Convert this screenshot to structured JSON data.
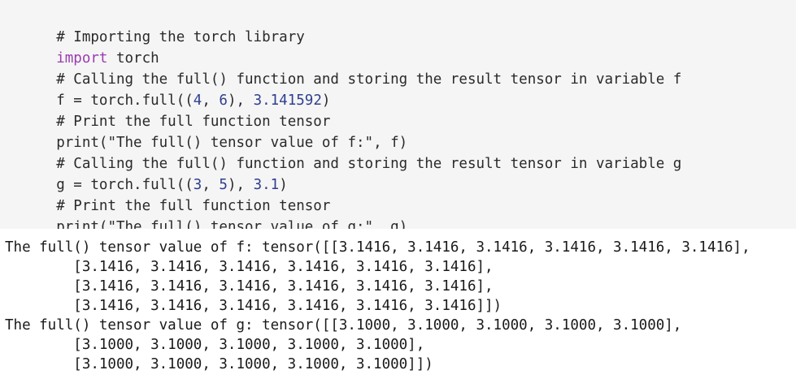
{
  "code_cell": {
    "lines": [
      {
        "comment": "# Importing the torch library"
      },
      {
        "keyword": "import",
        "rest": " torch"
      },
      {
        "comment": "# Calling the full() function and storing the result tensor in variable f"
      },
      {
        "pre": "f = torch.full((",
        "n1": "4",
        "mid1": ", ",
        "n2": "6",
        "mid2": "), ",
        "n3": "3.141592",
        "post": ")"
      },
      {
        "comment": "# Print the full function tensor"
      },
      {
        "pre": "print(",
        "string": "\"The full() tensor value of f:\"",
        "post": ", f)"
      },
      {
        "comment": "# Calling the full() function and storing the result tensor in variable g"
      },
      {
        "pre": "g = torch.full((",
        "n1": "3",
        "mid1": ", ",
        "n2": "5",
        "mid2": "), ",
        "n3": "3.1",
        "post": ")"
      },
      {
        "comment": "# Print the full function tensor"
      },
      {
        "pre": "print(",
        "string": "\"The full() tensor value of g:\"",
        "post": ", g)"
      }
    ]
  },
  "output_cell": {
    "lines": [
      "The full() tensor value of f: tensor([[3.1416, 3.1416, 3.1416, 3.1416, 3.1416, 3.1416],",
      "        [3.1416, 3.1416, 3.1416, 3.1416, 3.1416, 3.1416],",
      "        [3.1416, 3.1416, 3.1416, 3.1416, 3.1416, 3.1416],",
      "        [3.1416, 3.1416, 3.1416, 3.1416, 3.1416, 3.1416]])",
      "The full() tensor value of g: tensor([[3.1000, 3.1000, 3.1000, 3.1000, 3.1000],",
      "        [3.1000, 3.1000, 3.1000, 3.1000, 3.1000],",
      "        [3.1000, 3.1000, 3.1000, 3.1000, 3.1000]])"
    ]
  }
}
